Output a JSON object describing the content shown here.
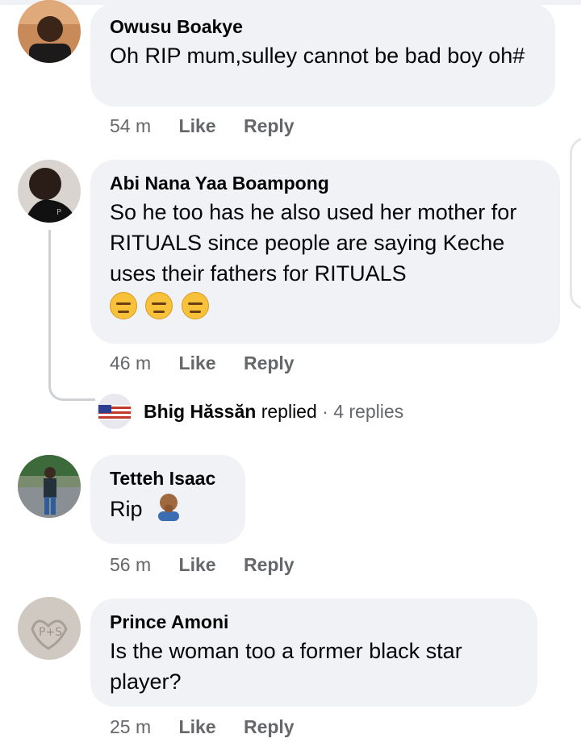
{
  "comments": [
    {
      "author": "Owusu Boakye",
      "text": "Oh RIP mum,sulley cannot be bad boy oh#",
      "time": "54 m",
      "like": "Like",
      "reply": "Reply"
    },
    {
      "author": "Abi Nana Yaa Boampong",
      "text": "So he too has he also used her mother for RITUALS since people are saying Keche uses their fathers for RITUALS",
      "emoji_count": 3,
      "time": "46 m",
      "like": "Like",
      "reply": "Reply",
      "replies_summary": {
        "name": "Bhig Hăssăn",
        "action": "replied",
        "separator": "·",
        "count_text": "4 replies"
      }
    },
    {
      "author": "Tetteh Isaac",
      "text": "Rip",
      "time": "56 m",
      "like": "Like",
      "reply": "Reply"
    },
    {
      "author": "Prince Amoni",
      "text": "Is the woman too a former black star player?",
      "time": "25 m",
      "like": "Like",
      "reply": "Reply"
    }
  ]
}
